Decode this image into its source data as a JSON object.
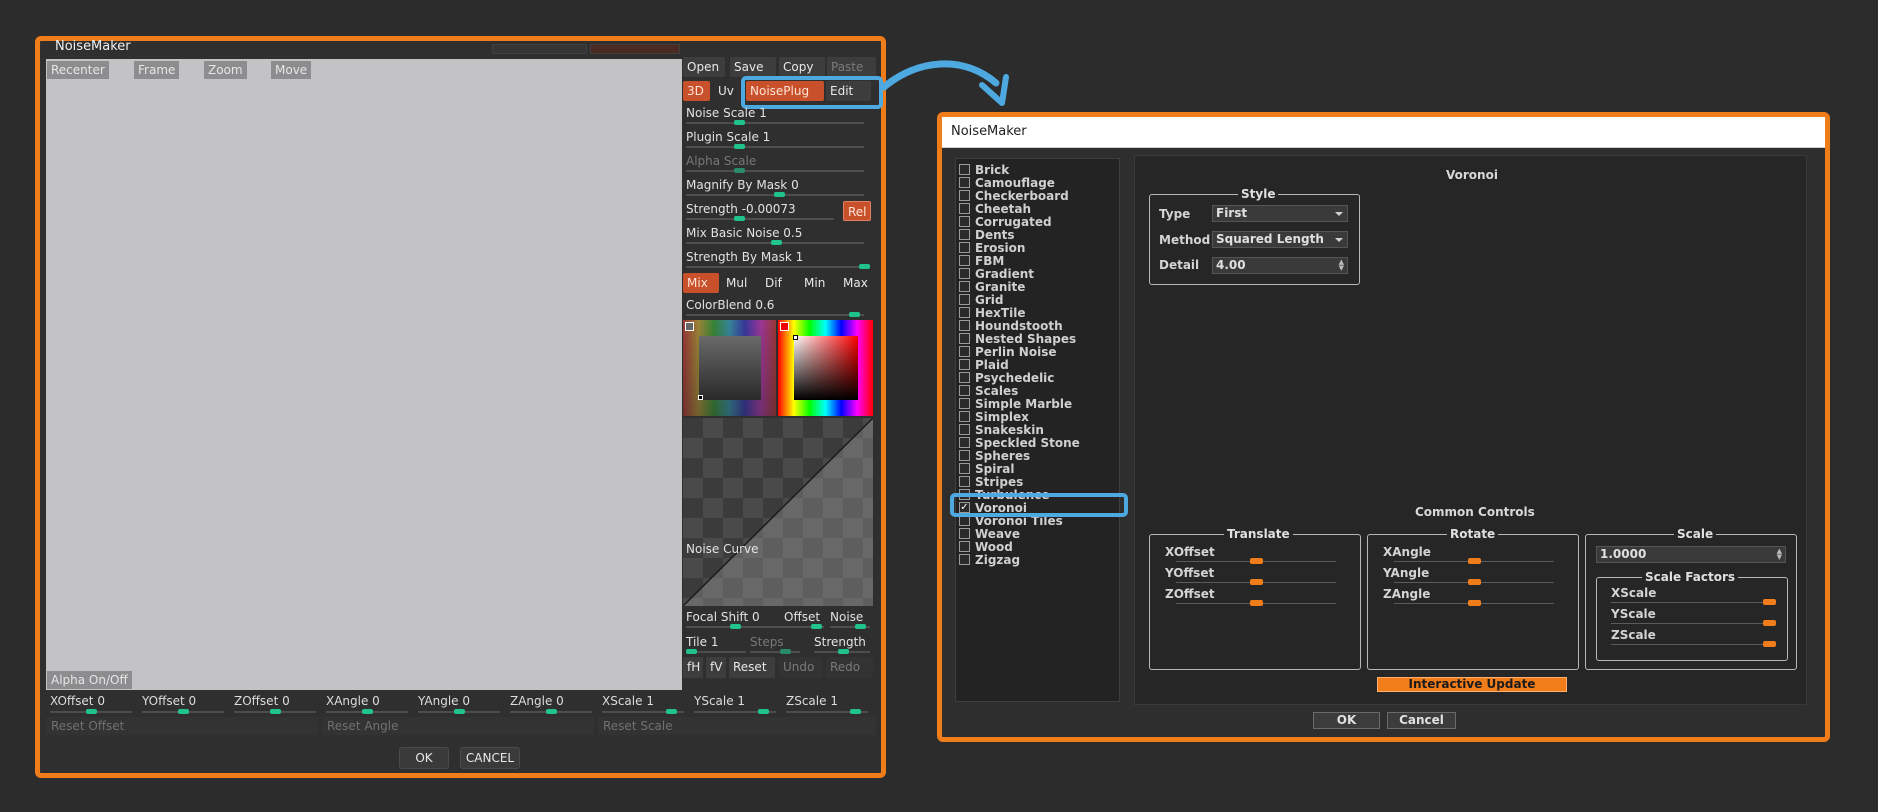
{
  "left": {
    "title": "NoiseMaker",
    "preview_buttons": [
      "Recenter",
      "Frame",
      "Zoom",
      "Move"
    ],
    "alpha_toggle": "Alpha On/Off",
    "file_buttons": {
      "open": "Open",
      "save": "Save",
      "copy": "Copy",
      "paste": "Paste"
    },
    "mode_buttons": {
      "d3": "3D",
      "uv": "Uv",
      "noiseplug": "NoisePlug",
      "edit": "Edit"
    },
    "sliders": {
      "noise_scale": "Noise Scale 1",
      "plugin_scale": "Plugin Scale 1",
      "alpha_scale": "Alpha Scale",
      "magnify_by_mask": "Magnify By Mask 0",
      "strength": "Strength -0.00073",
      "mix_basic_noise": "Mix Basic Noise 0.5",
      "strength_by_mask": "Strength By Mask 1",
      "colorblend": "ColorBlend 0.6"
    },
    "rel_button": "Rel",
    "blend_modes": [
      "Mix",
      "Mul",
      "Dif",
      "Min",
      "Max"
    ],
    "noise_curve_label": "Noise Curve",
    "curve_controls": {
      "focal_shift": "Focal Shift 0",
      "offset": "Offset",
      "noise": "Noise",
      "tile": "Tile 1",
      "steps": "Steps",
      "strength": "Strength"
    },
    "curve_buttons": {
      "fh": "fH",
      "fv": "fV",
      "reset": "Reset",
      "undo": "Undo",
      "redo": "Redo"
    },
    "transform": [
      {
        "label": "XOffset 0",
        "knob": 0.5
      },
      {
        "label": "YOffset 0",
        "knob": 0.5
      },
      {
        "label": "ZOffset 0",
        "knob": 0.5
      },
      {
        "label": "XAngle 0",
        "knob": 0.5
      },
      {
        "label": "YAngle 0",
        "knob": 0.5
      },
      {
        "label": "ZAngle 0",
        "knob": 0.5
      },
      {
        "label": "XScale 1",
        "knob": 0.9
      },
      {
        "label": "YScale 1",
        "knob": 0.9
      },
      {
        "label": "ZScale 1",
        "knob": 0.9
      }
    ],
    "reset_buttons": {
      "offset": "Reset Offset",
      "angle": "Reset Angle",
      "scale": "Reset Scale"
    },
    "ok": "OK",
    "cancel": "CANCEL"
  },
  "right": {
    "title": "NoiseMaker",
    "noise_types": [
      "Brick",
      "Camouflage",
      "Checkerboard",
      "Cheetah",
      "Corrugated",
      "Dents",
      "Erosion",
      "FBM",
      "Gradient",
      "Granite",
      "Grid",
      "HexTile",
      "Houndstooth",
      "Nested Shapes",
      "Perlin Noise",
      "Plaid",
      "Psychedelic",
      "Scales",
      "Simple Marble",
      "Simplex",
      "Snakeskin",
      "Speckled Stone",
      "Spheres",
      "Spiral",
      "Stripes",
      "Turbulence",
      "Voronoi",
      "Voronoi Tiles",
      "Weave",
      "Wood",
      "Zigzag"
    ],
    "selected_noise": "Voronoi",
    "panel_title": "Voronoi",
    "style": {
      "legend": "Style",
      "type_label": "Type",
      "type_value": "First",
      "method_label": "Method",
      "method_value": "Squared Length",
      "detail_label": "Detail",
      "detail_value": "4.00"
    },
    "common_controls_title": "Common Controls",
    "translate": {
      "legend": "Translate",
      "x": "XOffset",
      "y": "YOffset",
      "z": "ZOffset"
    },
    "rotate": {
      "legend": "Rotate",
      "x": "XAngle",
      "y": "YAngle",
      "z": "ZAngle"
    },
    "scale": {
      "legend": "Scale",
      "value": "1.0000",
      "factors_legend": "Scale Factors",
      "x": "XScale",
      "y": "YScale",
      "z": "ZScale"
    },
    "interactive_update": "Interactive Update",
    "ok": "OK",
    "cancel": "Cancel"
  },
  "colors": {
    "accent_orange": "#f07c1a",
    "highlight_blue": "#4da9e0",
    "slider_green": "#21c38d",
    "active_button": "#c8502a"
  }
}
